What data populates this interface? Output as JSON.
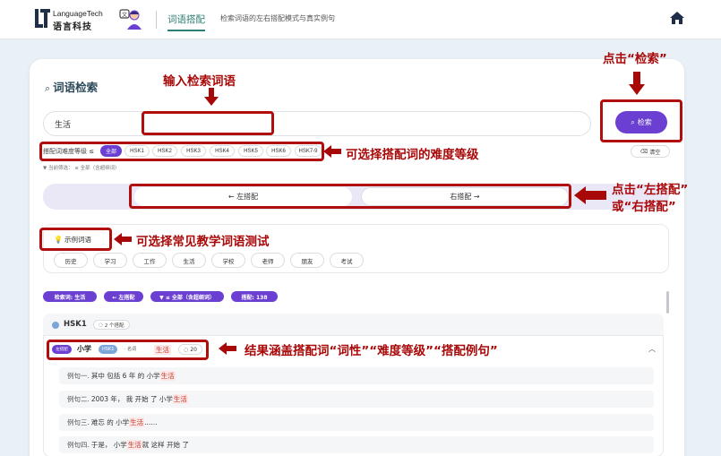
{
  "header": {
    "logo_en": "LanguageTech",
    "logo_cn": "语言科技",
    "nav_tab": "词语搭配",
    "nav_desc": "检索词语的左右搭配模式与真实例句"
  },
  "search": {
    "title": "词语检索",
    "input_value": "生活",
    "button_label": "检索"
  },
  "level_filter": {
    "label": "搭配词难度等级 ≤",
    "options": [
      "全部",
      "HSK1",
      "HSK2",
      "HSK3",
      "HSK4",
      "HSK5",
      "HSK6",
      "HSK7-9"
    ],
    "selected": "全部",
    "clear_label": "清空",
    "note": "▼ 当前筛选： ≤ 全部（含超纲词）"
  },
  "direction": {
    "left_label": "← 左搭配",
    "right_label": "右搭配 →"
  },
  "examples": {
    "title": "示例词语",
    "words": [
      "历史",
      "学习",
      "工作",
      "生活",
      "学校",
      "老师",
      "朋友",
      "考试"
    ]
  },
  "result_tags": [
    "检索词: 生活",
    "← 左搭配",
    "▼ ≤ 全部（含超纲词）",
    "搭配: 138"
  ],
  "group": {
    "title": "HSK1",
    "count": "2 个搭配",
    "collocation": {
      "pos_tag": "左搭配",
      "word": "小学",
      "hsk": "HSK1",
      "pos": "· 名词",
      "target": "生活",
      "example_count": "20"
    },
    "sentences": [
      {
        "label": "例句一.",
        "before": "其中 包括 6 年 的 小学 ",
        "hl": "生活",
        "after": ""
      },
      {
        "label": "例句二.",
        "before": "2003 年， 我 开始 了 小学 ",
        "hl": "生活",
        "after": ""
      },
      {
        "label": "例句三.",
        "before": "难忘 的 小学 ",
        "hl": "生活",
        "after": " ......"
      },
      {
        "label": "例句四.",
        "before": "于是， 小学 ",
        "hl": "生活",
        "after": " 就 这样 开始 了"
      }
    ]
  },
  "annotations": {
    "input": "输入检索词语",
    "click_search": "点击“检索”",
    "level": "可选择搭配词的难度等级",
    "direction_line1": "点击“左搭配”",
    "direction_line2": "或“右搭配”",
    "examples": "可选择常见教学词语测试",
    "results": "结果涵盖搭配词“词性”“难度等级”“搭配例句”"
  },
  "colors": {
    "accent": "#6b3fd1",
    "teal": "#2f7d73",
    "annotation": "#b00d0d"
  }
}
